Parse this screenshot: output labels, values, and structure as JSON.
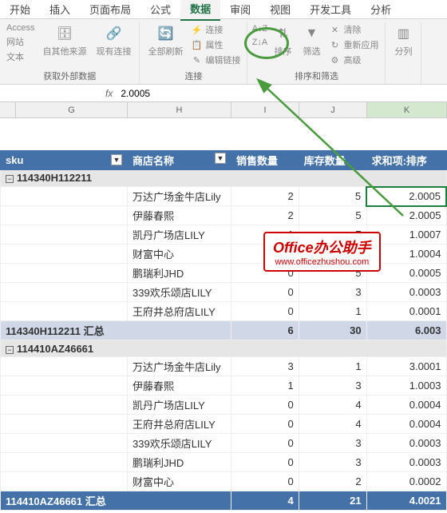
{
  "tabs": [
    "开始",
    "插入",
    "页面布局",
    "公式",
    "数据",
    "审阅",
    "视图",
    "开发工具",
    "分析"
  ],
  "active_tab": "数据",
  "ribbon": {
    "g1_items": [
      "Access",
      "网站",
      "文本"
    ],
    "g1_other": "自其他来源",
    "g1_conn": "现有连接",
    "g1_label": "获取外部数据",
    "g2_refresh": "全部刷新",
    "g2_items": [
      "连接",
      "属性",
      "编辑链接"
    ],
    "g2_label": "连接",
    "g3_az": "A↓Z",
    "g3_za": "Z↓A",
    "g3_sort": "排序",
    "g3_filter": "筛选",
    "g3_items": [
      "清除",
      "重新应用",
      "高级"
    ],
    "g3_label": "排序和筛选",
    "g4_split": "分列"
  },
  "formula_value": "2.0005",
  "columns": [
    "G",
    "H",
    "I",
    "J",
    "K"
  ],
  "table": {
    "headers": [
      "sku",
      "商店名称",
      "销售数量",
      "库存数量",
      "求和项:排序"
    ],
    "groups": [
      {
        "key": "114340H112211",
        "rows": [
          [
            "万达广场金牛店Lily",
            "2",
            "5",
            "2.0005"
          ],
          [
            "伊藤春熙",
            "2",
            "5",
            "2.0005"
          ],
          [
            "凯丹广场店LILY",
            "1",
            "7",
            "1.0007"
          ],
          [
            "财富中心",
            "1",
            "4",
            "1.0004"
          ],
          [
            "鹏瑞利JHD",
            "0",
            "5",
            "0.0005"
          ],
          [
            "339欢乐颂店LILY",
            "0",
            "3",
            "0.0003"
          ],
          [
            "王府井总府店LILY",
            "0",
            "1",
            "0.0001"
          ]
        ],
        "total_label": "114340H112211 汇总",
        "totals": [
          "6",
          "30",
          "6.003"
        ]
      },
      {
        "key": "114410AZ46661",
        "rows": [
          [
            "万达广场金牛店Lily",
            "3",
            "1",
            "3.0001"
          ],
          [
            "伊藤春熙",
            "1",
            "3",
            "1.0003"
          ],
          [
            "凯丹广场店LILY",
            "0",
            "4",
            "0.0004"
          ],
          [
            "王府井总府店LILY",
            "0",
            "4",
            "0.0004"
          ],
          [
            "339欢乐颂店LILY",
            "0",
            "3",
            "0.0003"
          ],
          [
            "鹏瑞利JHD",
            "0",
            "3",
            "0.0003"
          ],
          [
            "财富中心",
            "0",
            "2",
            "0.0002"
          ]
        ],
        "total_label": "114410AZ46661 汇总",
        "totals": [
          "4",
          "21",
          "4.0021"
        ]
      }
    ]
  },
  "watermark": {
    "title": "Office办公助手",
    "url": "www.officezhushou.com"
  }
}
